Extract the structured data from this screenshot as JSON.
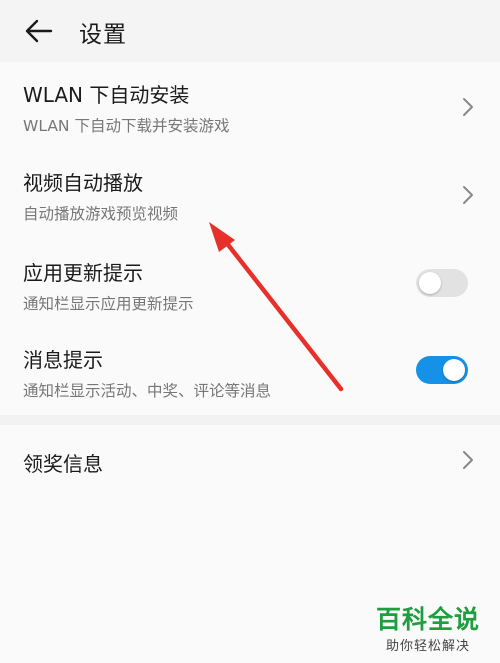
{
  "header": {
    "title": "设置",
    "back_icon": "arrow-left-icon"
  },
  "settings": {
    "wlan": {
      "title": "WLAN 下自动安装",
      "subtitle": "WLAN 下自动下载并安装游戏"
    },
    "video": {
      "title": "视频自动播放",
      "subtitle": "自动播放游戏预览视频"
    },
    "update": {
      "title": "应用更新提示",
      "subtitle": "通知栏显示应用更新提示",
      "enabled": false
    },
    "message": {
      "title": "消息提示",
      "subtitle": "通知栏显示活动、中奖、评论等消息",
      "enabled": true
    },
    "prize": {
      "title": "领奖信息"
    }
  },
  "watermark": {
    "main": "百科全说",
    "sub": "助你轻松解决"
  },
  "colors": {
    "accent": "#1592e8",
    "annotation_arrow": "#e8302a",
    "watermark_green": "#1e9e3e"
  }
}
